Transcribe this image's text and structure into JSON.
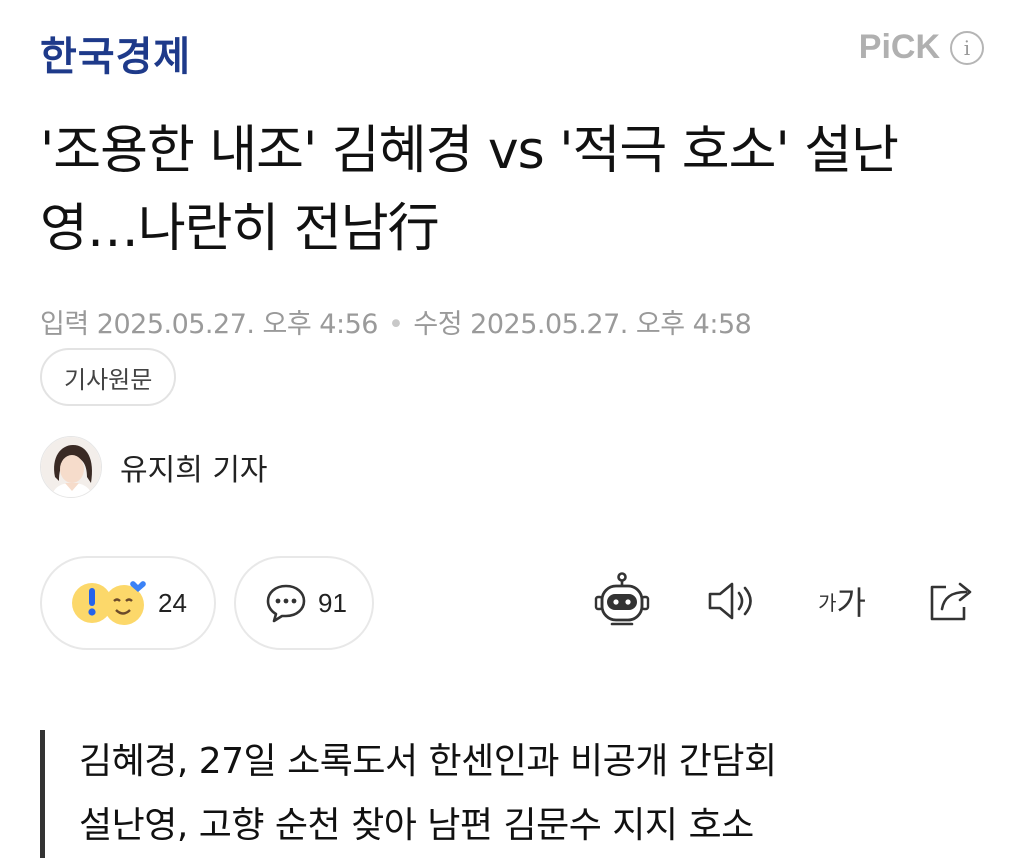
{
  "header": {
    "logo": "한국경제",
    "pick_label": "PiCK",
    "info_icon": "info-icon"
  },
  "article": {
    "title": "'조용한 내조' 김혜경 vs '적극 호소' 설난영…나란히 전남行",
    "input_label": "입력",
    "input_time": "2025.05.27. 오후 4:56",
    "modified_label": "수정",
    "modified_time": "2025.05.27. 오후 4:58",
    "original_button": "기사원문",
    "author": "유지희 기자",
    "summary": [
      "김혜경, 27일 소록도서 한센인과 비공개 간담회",
      "설난영, 고향 순천 찾아 남편 김문수 지지 호소"
    ]
  },
  "actions": {
    "reaction_count": "24",
    "comment_count": "91",
    "icons": [
      "surprised-emoji-icon",
      "smile-emoji-icon",
      "comment-bubble-icon",
      "robot-summary-icon",
      "speaker-icon",
      "font-size-icon",
      "share-icon"
    ],
    "font_size_small": "가",
    "font_size_big": "가"
  },
  "colors": {
    "logo": "#1e3a8a",
    "muted": "#9a9a9a",
    "border": "#e8e8e8"
  }
}
